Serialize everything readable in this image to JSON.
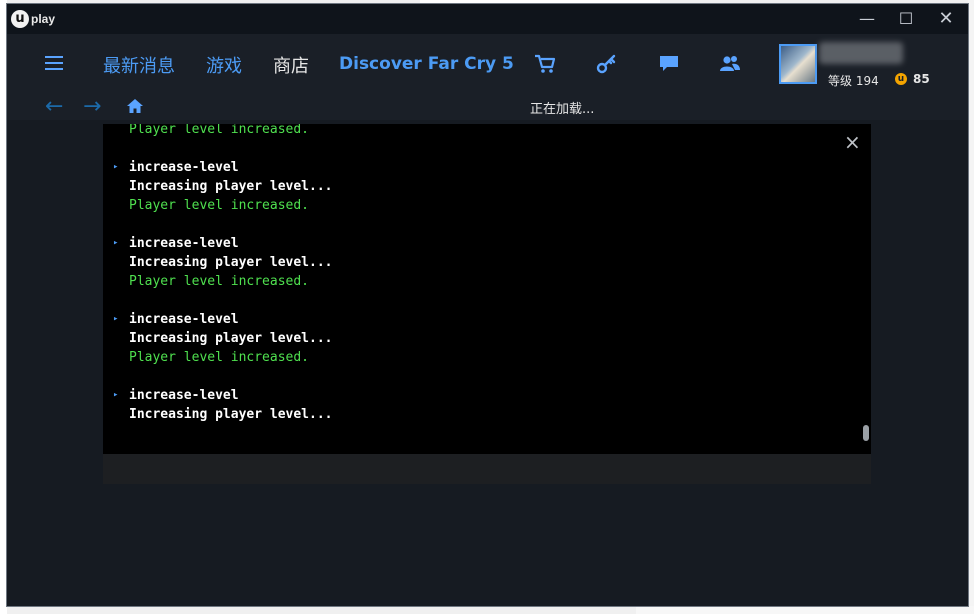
{
  "window": {
    "logo_badge": "u",
    "logo_text": "play",
    "controls": {
      "minimize": "—",
      "maximize": "☐",
      "close": "✕"
    }
  },
  "nav": {
    "items": [
      "最新消息",
      "游戏",
      "商店"
    ],
    "promo": "Discover Far Cry 5",
    "icons": [
      "cart-icon",
      "key-icon",
      "chat-icon",
      "friends-icon"
    ],
    "accent_color": "#4c9bf4"
  },
  "profile": {
    "level_label": "等级",
    "level_value": "194",
    "coin_symbol": "u",
    "coins": "85"
  },
  "subnav": {
    "back": "←",
    "forward": "→",
    "loading_text": "正在加载..."
  },
  "console": {
    "close": "×",
    "lines": [
      {
        "type": "ok",
        "text": "Player level increased."
      },
      {
        "type": "blank",
        "text": ""
      },
      {
        "type": "cmd",
        "text": "increase-level"
      },
      {
        "type": "info",
        "text": "Increasing player level..."
      },
      {
        "type": "ok",
        "text": "Player level increased."
      },
      {
        "type": "blank",
        "text": ""
      },
      {
        "type": "cmd",
        "text": "increase-level"
      },
      {
        "type": "info",
        "text": "Increasing player level..."
      },
      {
        "type": "ok",
        "text": "Player level increased."
      },
      {
        "type": "blank",
        "text": ""
      },
      {
        "type": "cmd",
        "text": "increase-level"
      },
      {
        "type": "info",
        "text": "Increasing player level..."
      },
      {
        "type": "ok",
        "text": "Player level increased."
      },
      {
        "type": "blank",
        "text": ""
      },
      {
        "type": "cmd",
        "text": "increase-level"
      },
      {
        "type": "info",
        "text": "Increasing player level..."
      }
    ],
    "prompt_symbol": "▸",
    "ok_color": "#4fe04f"
  }
}
